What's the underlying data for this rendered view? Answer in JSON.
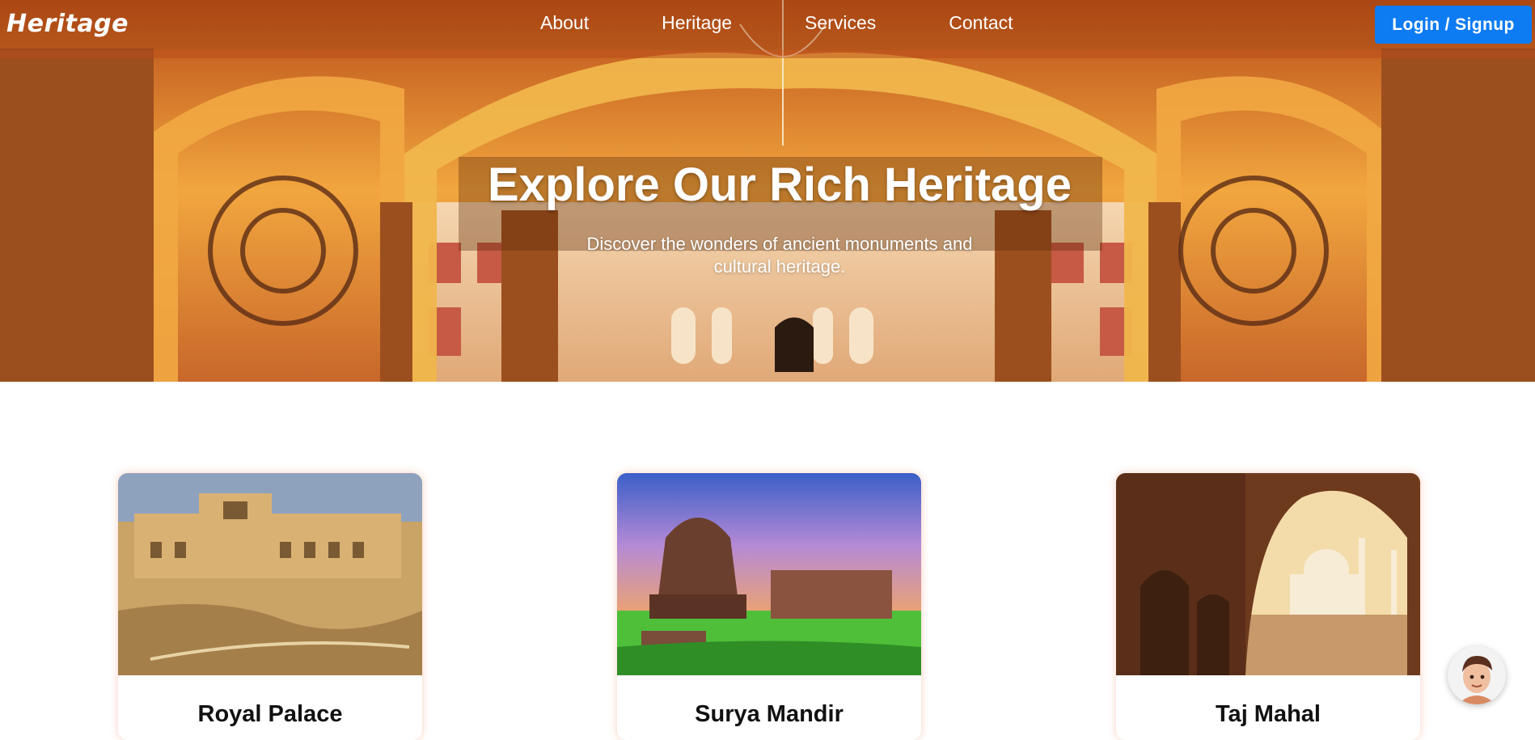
{
  "brand": {
    "logo": "Heritage"
  },
  "nav": {
    "links": [
      "About",
      "Heritage",
      "Services",
      "Contact"
    ],
    "login_label": "Login / Signup"
  },
  "hero": {
    "title": "Explore Our Rich Heritage",
    "subtitle": "Discover the wonders of ancient monuments and cultural heritage."
  },
  "cards": [
    {
      "title": "Royal Palace",
      "image": "amber-fort-photo"
    },
    {
      "title": "Surya Mandir",
      "image": "sun-temple-photo"
    },
    {
      "title": "Taj Mahal",
      "image": "taj-mahal-photo"
    }
  ],
  "chat": {
    "icon": "chat-assistant-avatar"
  },
  "colors": {
    "accent": "#0d7bf2",
    "hero_warm": "#e07d2c",
    "card_glow": "#f0966e"
  }
}
